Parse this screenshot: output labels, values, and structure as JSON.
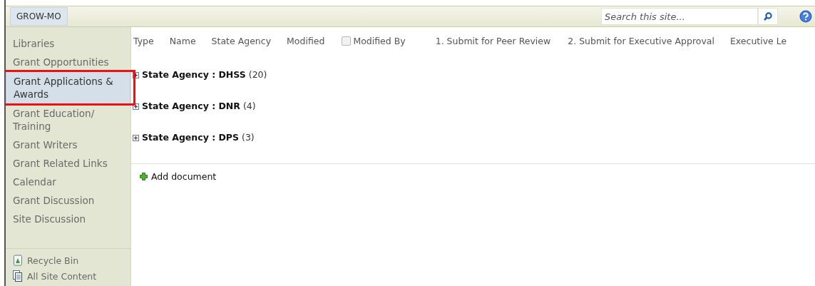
{
  "top_bar": {
    "site_title": "GROW-MO",
    "search": {
      "placeholder": "Search this site..."
    }
  },
  "sidebar": {
    "items": [
      {
        "label": "Libraries",
        "selected": false,
        "annotated": false
      },
      {
        "label": "Grant Opportunities",
        "selected": false,
        "annotated": false
      },
      {
        "label": "Grant Applications & Awards",
        "selected": true,
        "annotated": true
      },
      {
        "label": "Grant Education/ Training",
        "selected": false,
        "annotated": false
      },
      {
        "label": "Grant Writers",
        "selected": false,
        "annotated": false
      },
      {
        "label": "Grant Related Links",
        "selected": false,
        "annotated": false
      },
      {
        "label": "Calendar",
        "selected": false,
        "annotated": false
      },
      {
        "label": "Grant Discussion",
        "selected": false,
        "annotated": false
      },
      {
        "label": "Site Discussion",
        "selected": false,
        "annotated": false
      }
    ],
    "footer_links": [
      {
        "label": "Recycle Bin",
        "kind": "bin"
      },
      {
        "label": "All Site Content",
        "kind": "content"
      }
    ]
  },
  "table": {
    "columns": [
      {
        "label": "Type",
        "kind": "text"
      },
      {
        "label": "Name",
        "kind": "text"
      },
      {
        "label": "State Agency",
        "kind": "text"
      },
      {
        "label": "Modified",
        "kind": "text"
      },
      {
        "label": "Modified By",
        "kind": "checkbox",
        "checked": false
      },
      {
        "label": "1. Submit for Peer Review",
        "kind": "text"
      },
      {
        "label": "2. Submit for Executive Approval",
        "kind": "text"
      },
      {
        "label": "Executive Le",
        "kind": "text"
      }
    ],
    "groups": [
      {
        "label": "State Agency : DHSS",
        "count": "(20)",
        "expanded": false
      },
      {
        "label": "State Agency : DNR",
        "count": "(4)",
        "expanded": false
      },
      {
        "label": "State Agency : DPS",
        "count": "(3)",
        "expanded": false
      }
    ],
    "add_link": "Add document"
  }
}
